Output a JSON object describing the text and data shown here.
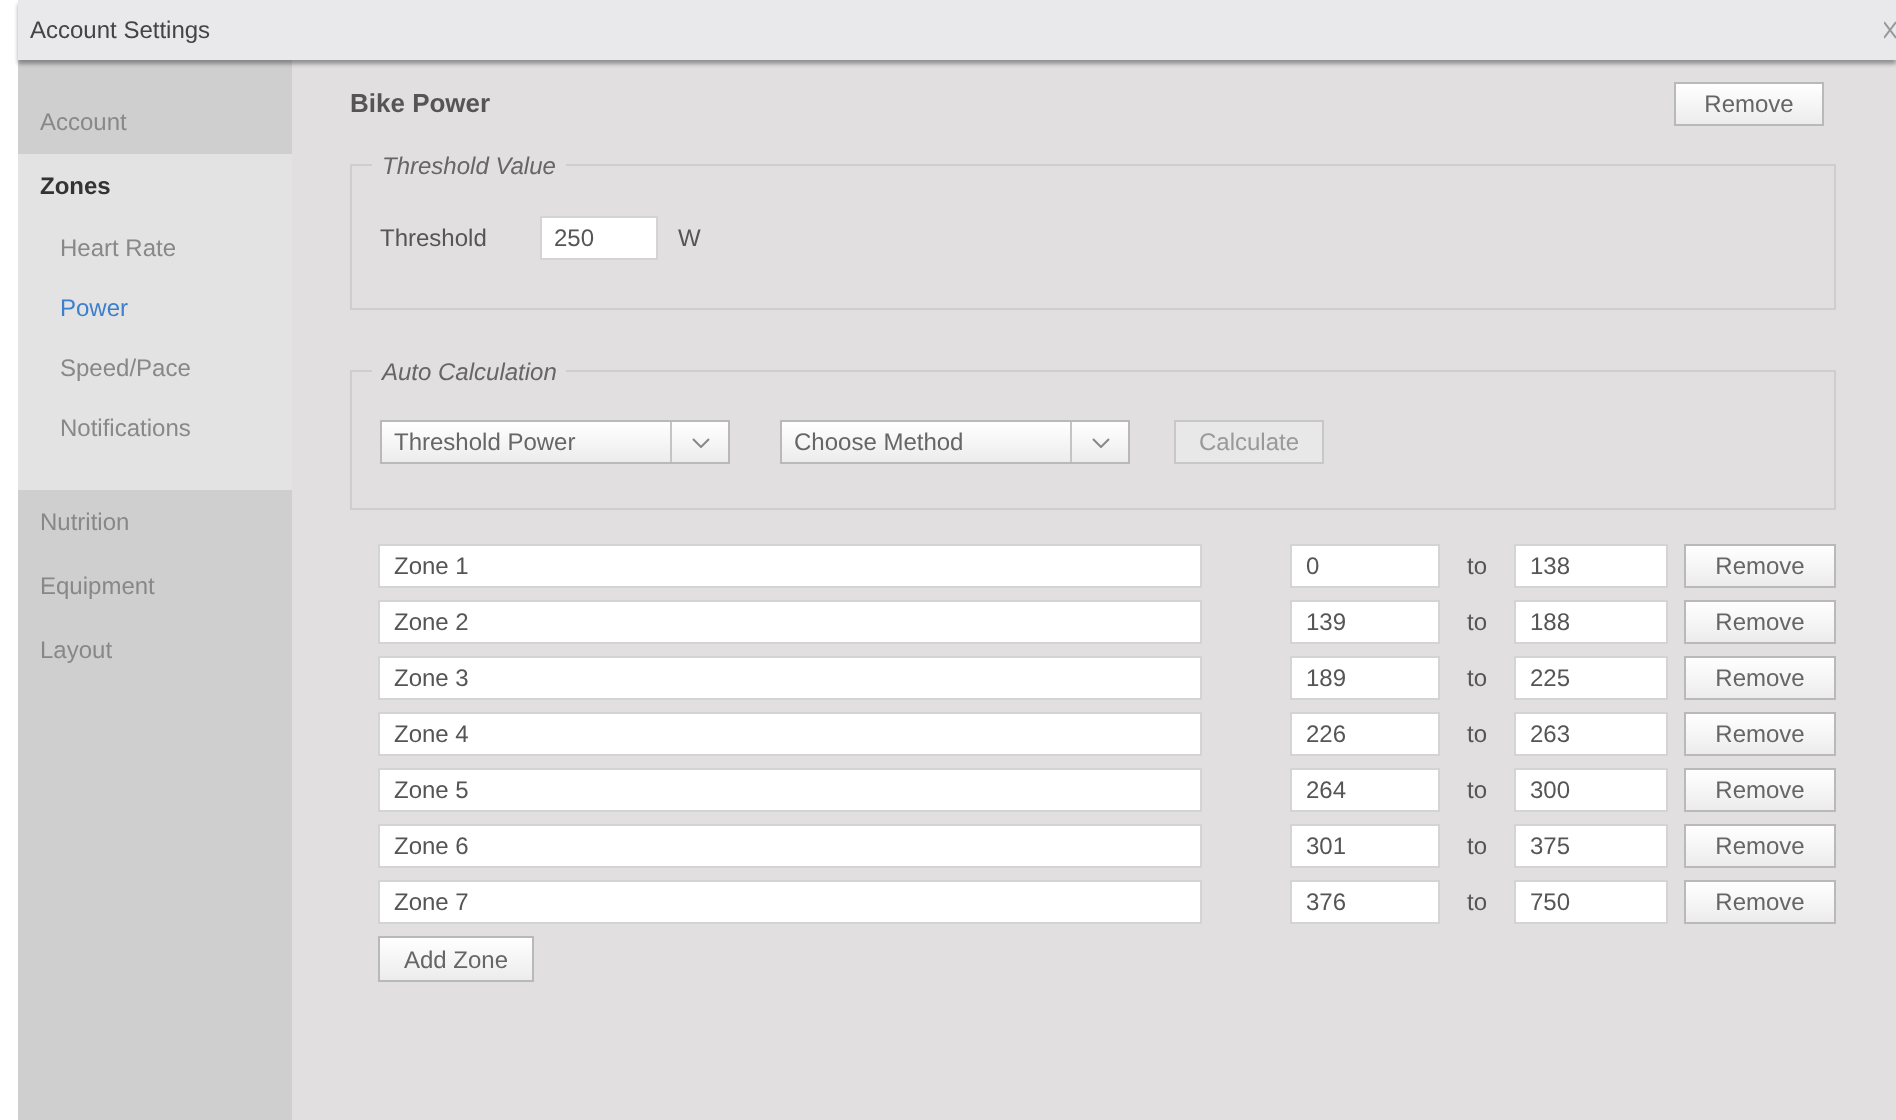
{
  "window": {
    "title": "Account Settings"
  },
  "sidebar": {
    "items": [
      {
        "label": "Account",
        "selected": false
      },
      {
        "label": "Zones",
        "selected": false,
        "expanded": true,
        "children": [
          {
            "label": "Heart Rate",
            "selected": false
          },
          {
            "label": "Power",
            "selected": true
          },
          {
            "label": "Speed/Pace",
            "selected": false
          },
          {
            "label": "Notifications",
            "selected": false
          }
        ]
      },
      {
        "label": "Nutrition",
        "selected": false
      },
      {
        "label": "Equipment",
        "selected": false
      },
      {
        "label": "Layout",
        "selected": false
      }
    ]
  },
  "section": {
    "title": "Bike Power",
    "remove_button": "Remove"
  },
  "threshold_value": {
    "legend": "Threshold Value",
    "label": "Threshold",
    "value": "250",
    "unit": "W"
  },
  "auto_calculation": {
    "legend": "Auto Calculation",
    "selects": [
      "Threshold Power",
      "Choose Method"
    ],
    "calculate_button": {
      "label": "Calculate",
      "disabled": true
    }
  },
  "zones": [
    {
      "name": "Zone 1",
      "from": "0",
      "to_label": "to",
      "to": "138",
      "remove": "Remove"
    },
    {
      "name": "Zone 2",
      "from": "139",
      "to_label": "to",
      "to": "188",
      "remove": "Remove"
    },
    {
      "name": "Zone 3",
      "from": "189",
      "to_label": "to",
      "to": "225",
      "remove": "Remove"
    },
    {
      "name": "Zone 4",
      "from": "226",
      "to_label": "to",
      "to": "263",
      "remove": "Remove"
    },
    {
      "name": "Zone 5",
      "from": "264",
      "to_label": "to",
      "to": "300",
      "remove": "Remove"
    },
    {
      "name": "Zone 6",
      "from": "301",
      "to_label": "to",
      "to": "375",
      "remove": "Remove"
    },
    {
      "name": "Zone 7",
      "from": "376",
      "to_label": "to",
      "to": "750",
      "remove": "Remove"
    }
  ],
  "add_zone_button": "Add Zone"
}
